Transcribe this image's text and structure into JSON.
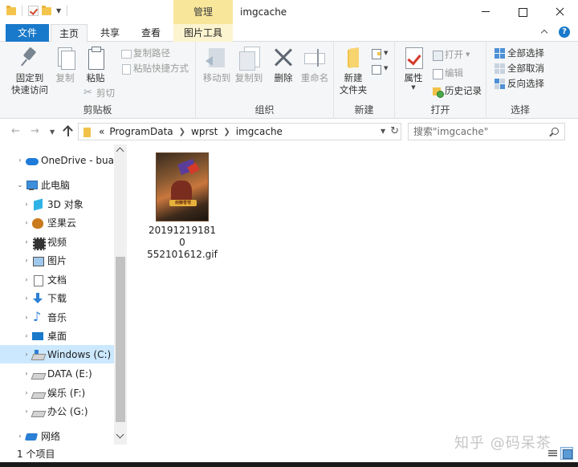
{
  "window": {
    "title": "imgcache",
    "context_tab_group": "管理"
  },
  "ribbon_tabs": {
    "file": "文件",
    "home": "主页",
    "share": "共享",
    "view": "查看",
    "picture_tools": "图片工具"
  },
  "ribbon": {
    "clipboard": {
      "label": "剪贴板",
      "pin": "固定到\n快速访问",
      "pin_line1": "固定到",
      "pin_line2": "快速访问",
      "copy": "复制",
      "paste": "粘贴",
      "copy_path": "复制路径",
      "paste_shortcut": "粘贴快捷方式",
      "cut": "剪切"
    },
    "organize": {
      "label": "组织",
      "move_to": "移动到",
      "copy_to": "复制到",
      "delete": "删除",
      "rename": "重命名"
    },
    "new": {
      "label": "新建",
      "new_folder_line1": "新建",
      "new_folder_line2": "文件夹"
    },
    "open": {
      "label": "打开",
      "properties": "属性",
      "open": "打开",
      "edit": "编辑",
      "history": "历史记录"
    },
    "select": {
      "label": "选择",
      "select_all": "全部选择",
      "select_none": "全部取消",
      "invert": "反向选择"
    }
  },
  "address": {
    "overflow": "«",
    "crumbs": [
      "ProgramData",
      "wprst",
      "imgcache"
    ],
    "search_placeholder": "搜索\"imgcache\""
  },
  "nav": {
    "items": [
      {
        "label": "OneDrive - buaa",
        "icon": "onedrive-cloud-icon"
      },
      {
        "label": "此电脑",
        "icon": "this-pc-icon"
      },
      {
        "label": "3D 对象",
        "icon": "3d-objects-icon"
      },
      {
        "label": "坚果云",
        "icon": "nutstore-icon"
      },
      {
        "label": "视频",
        "icon": "videos-icon"
      },
      {
        "label": "图片",
        "icon": "pictures-icon"
      },
      {
        "label": "文档",
        "icon": "documents-icon"
      },
      {
        "label": "下载",
        "icon": "downloads-icon"
      },
      {
        "label": "音乐",
        "icon": "music-icon"
      },
      {
        "label": "桌面",
        "icon": "desktop-icon"
      },
      {
        "label": "Windows (C:)",
        "icon": "windows-drive-icon"
      },
      {
        "label": "DATA (E:)",
        "icon": "drive-icon"
      },
      {
        "label": "娱乐 (F:)",
        "icon": "drive-icon"
      },
      {
        "label": "办公 (G:)",
        "icon": "drive-icon"
      },
      {
        "label": "网络",
        "icon": "network-icon"
      }
    ]
  },
  "files": [
    {
      "name_line1": "201912191810",
      "name_line2": "552101612.gif",
      "thumb_banner": "剑御苍穹"
    }
  ],
  "status": {
    "item_count": "1 个项目"
  },
  "watermark": "知乎 @码呆茶",
  "colors": {
    "file_tab": "#1979ca",
    "manage_tab": "#f8e79b",
    "selected_nav": "#cce8ff",
    "ribbon_bg": "#f5f6f7"
  }
}
